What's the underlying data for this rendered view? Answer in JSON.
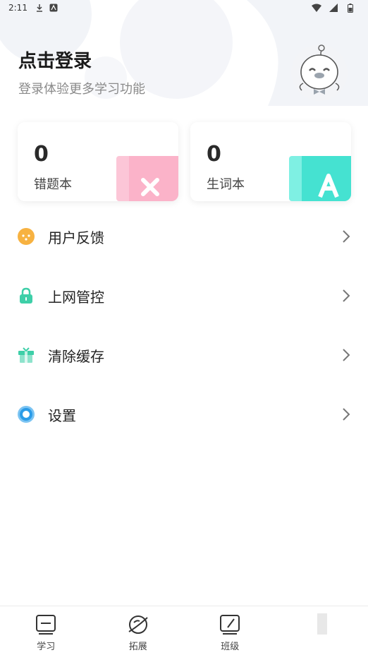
{
  "status_bar": {
    "time": "2:11"
  },
  "header": {
    "title": "点击登录",
    "subtitle": "登录体验更多学习功能"
  },
  "cards": [
    {
      "count": "0",
      "label": "错题本",
      "accent": "#f9a9c3"
    },
    {
      "count": "0",
      "label": "生词本",
      "accent": "#3fe0d0"
    }
  ],
  "menu": [
    {
      "label": "用户反馈",
      "icon": "feedback-icon",
      "color": "#f5a623"
    },
    {
      "label": "上网管控",
      "icon": "lock-icon",
      "color": "#3ecfa8"
    },
    {
      "label": "清除缓存",
      "icon": "gift-box-icon",
      "color": "#3ecfa8"
    },
    {
      "label": "设置",
      "icon": "gear-icon",
      "color": "#2b9ce8"
    }
  ],
  "tabs": [
    {
      "label": "学习",
      "icon": "book-icon"
    },
    {
      "label": "拓展",
      "icon": "planet-icon"
    },
    {
      "label": "班级",
      "icon": "edit-note-icon"
    },
    {
      "label": "",
      "icon": "profile-icon"
    }
  ]
}
